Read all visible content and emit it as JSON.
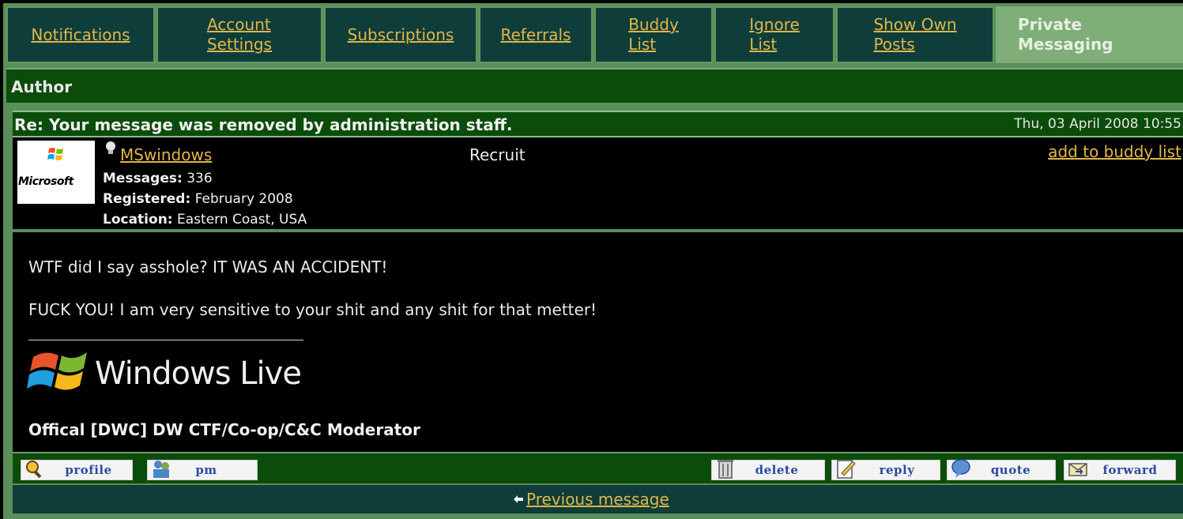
{
  "tabs": [
    {
      "label_line1": "Notifications",
      "label_line2": ""
    },
    {
      "label_line1": "Account",
      "label_line2": "Settings"
    },
    {
      "label_line1": "Subscriptions",
      "label_line2": ""
    },
    {
      "label_line1": "Referrals",
      "label_line2": ""
    },
    {
      "label_line1": "Buddy",
      "label_line2": "List"
    },
    {
      "label_line1": "Ignore",
      "label_line2": "List"
    },
    {
      "label_line1": "Show Own",
      "label_line2": "Posts"
    },
    {
      "label_line1": "Private",
      "label_line2": "Messaging"
    }
  ],
  "author_header": "Author",
  "message": {
    "subject": "Re: Your message was removed by administration staff.",
    "date": "Thu, 03 April 2008 10:55",
    "user": {
      "avatar_text": "Microsoft",
      "name": "MSwindows",
      "rank": "Recruit",
      "add_buddy": "add to buddy list",
      "messages_label": "Messages:",
      "messages_value": "336",
      "registered_label": "Registered:",
      "registered_value": "February 2008",
      "location_label": "Location:",
      "location_value": "Eastern Coast, USA"
    },
    "body_line1": "WTF did I say asshole? IT WAS AN ACCIDENT!",
    "body_line2": "FUCK YOU! I am very sensitive to your shit and any shit for that metter!",
    "logo_text": "Windows Live",
    "signature": "Offical [DWC] DW CTF/Co-op/C&C Moderator"
  },
  "actions": {
    "profile": "profile",
    "pm": "pm",
    "delete": "delete",
    "reply": "reply",
    "quote": "quote",
    "forward": "forward"
  },
  "prev_message": "Previous message",
  "colors": {
    "tab_bg": "#0e3d3a",
    "link": "#e0b64a",
    "header_green": "#0b4c0b",
    "active_tab": "#7fae79"
  }
}
